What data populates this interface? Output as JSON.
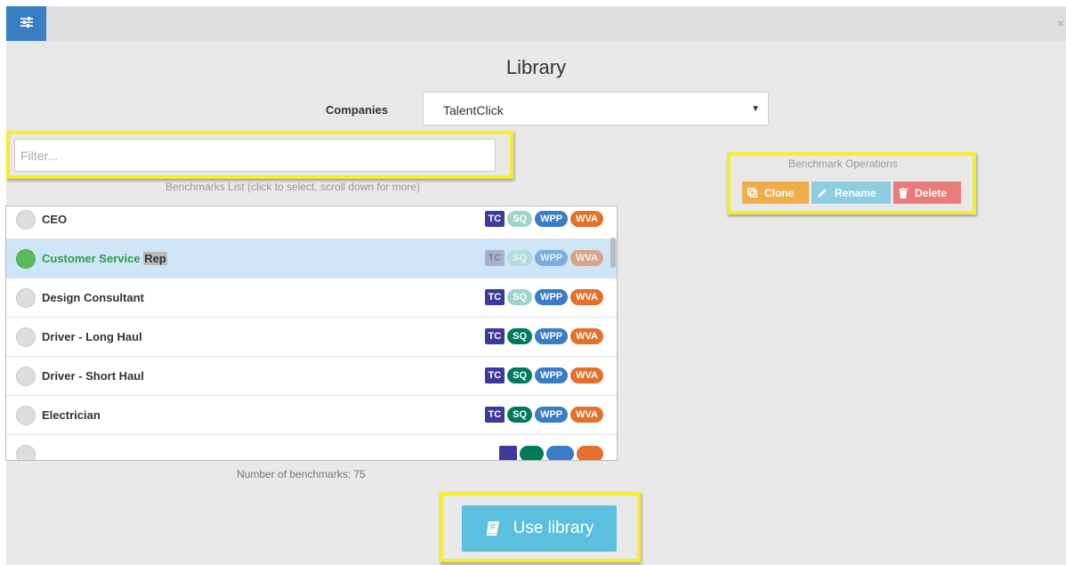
{
  "header": {
    "close_label": "×",
    "settings_icon": "sliders-icon"
  },
  "title": "Library",
  "companies": {
    "label": "Companies",
    "selected": "TalentClick",
    "caret": "▼"
  },
  "filter": {
    "placeholder": "Filter..."
  },
  "list": {
    "caption": "Benchmarks List (click to select, scroll down for more)",
    "items": [
      {
        "label": "CEO",
        "tags": [
          "TC",
          "SQ",
          "WPP",
          "WVA"
        ],
        "sq_light": true,
        "selected": false
      },
      {
        "label": "Customer Service",
        "label_highlight": "Rep",
        "tags": [
          "TC",
          "SQ",
          "WPP",
          "WVA"
        ],
        "sq_light": true,
        "selected": true
      },
      {
        "label": "Design Consultant",
        "tags": [
          "TC",
          "SQ",
          "WPP",
          "WVA"
        ],
        "sq_light": true,
        "selected": false
      },
      {
        "label": "Driver - Long Haul",
        "tags": [
          "TC",
          "SQ",
          "WPP",
          "WVA"
        ],
        "sq_light": false,
        "selected": false
      },
      {
        "label": "Driver - Short Haul",
        "tags": [
          "TC",
          "SQ",
          "WPP",
          "WVA"
        ],
        "sq_light": false,
        "selected": false
      },
      {
        "label": "Electrician",
        "tags": [
          "TC",
          "SQ",
          "WPP",
          "WVA"
        ],
        "sq_light": false,
        "selected": false
      }
    ],
    "count_text": "Number of benchmarks: 75"
  },
  "operations": {
    "title": "Benchmark Operations",
    "clone": "Clone",
    "rename": "Rename",
    "delete": "Delete"
  },
  "use_library": {
    "label": "Use library"
  },
  "colors": {
    "primary": "#3a7fc1",
    "highlight": "#f3ef2f",
    "tc": "#3d3a9c",
    "sq": "#007a5a",
    "wpp": "#3a7cc7",
    "wva": "#e3702b",
    "clone": "#f0ad4e",
    "rename": "#8ccde3",
    "delete": "#e87c7a",
    "info": "#5bc0de"
  }
}
